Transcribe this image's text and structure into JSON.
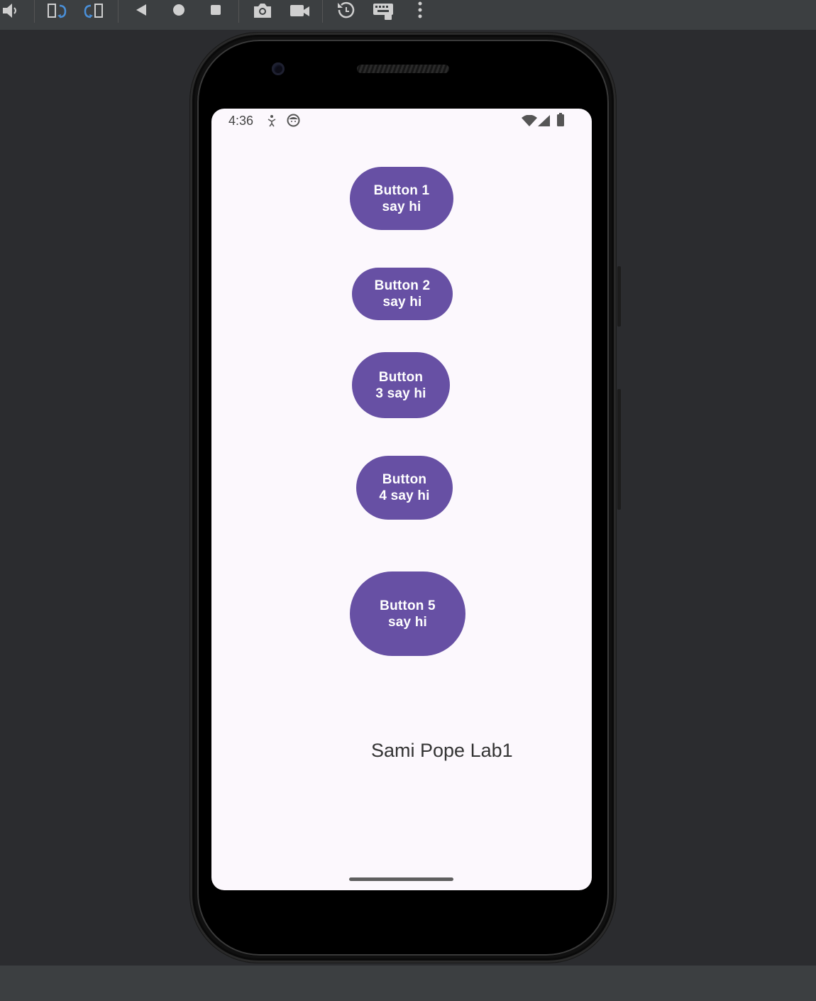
{
  "toolbar": {
    "icons": [
      "volume-down-icon",
      "rotate-left-icon",
      "rotate-right-icon",
      "back-icon",
      "home-icon",
      "overview-icon",
      "camera-icon",
      "video-icon",
      "snapshot-icon",
      "keyboard-icon",
      "more-icon"
    ],
    "accent": "#4a90d9"
  },
  "status_bar": {
    "time": "4:36",
    "left_icons": [
      "accessibility-icon",
      "notification-face-icon"
    ],
    "right_icons": [
      "wifi-icon",
      "cell-signal-icon",
      "battery-icon"
    ]
  },
  "buttons": [
    {
      "line1": "Button 1",
      "line2": "say hi"
    },
    {
      "line1": "Button 2",
      "line2": "say hi"
    },
    {
      "line1": "Button",
      "line2": "3 say hi"
    },
    {
      "line1": "Button",
      "line2": "4 say hi"
    },
    {
      "line1": "Button 5",
      "line2": "say hi"
    }
  ],
  "label": "Sami Pope Lab1",
  "colors": {
    "button_bg": "#6750a4",
    "button_text": "#ffffff",
    "screen_bg": "#fcf8fd"
  }
}
